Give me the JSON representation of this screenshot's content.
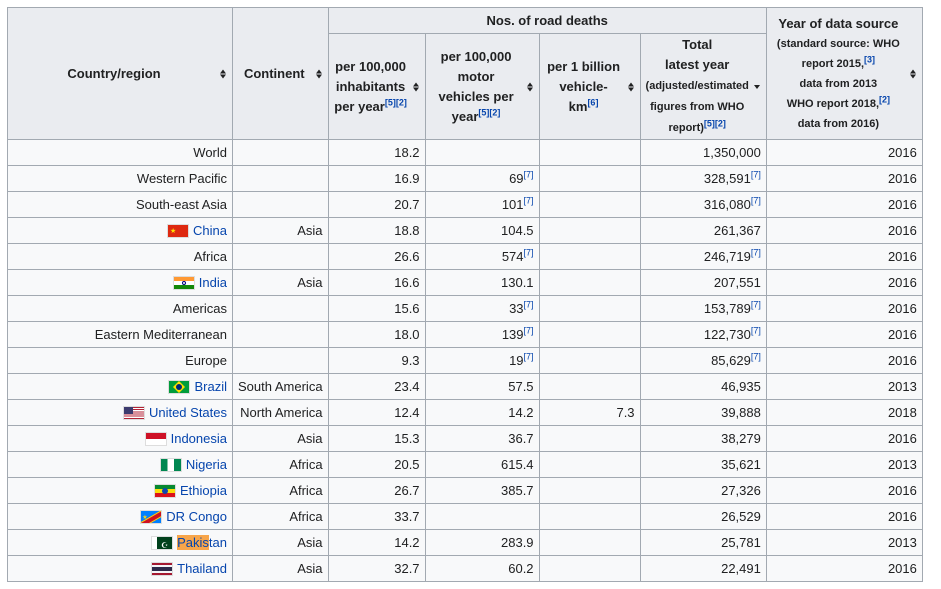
{
  "headers": {
    "country": "Country/region",
    "continent": "Continent",
    "road_deaths_group": "Nos. of road deaths",
    "per_inhabitants": "per 100,000 inhabitants per year",
    "per_inhabitants_refs": "[5][2]",
    "per_vehicles": "per 100,000 motor vehicles per year",
    "per_vehicles_refs": "[5][2]",
    "per_km_line1": "per 1 billion",
    "per_km_line2": "vehicle-km",
    "per_km_refs": "[6]",
    "total_line1": "Total",
    "total_line2": "latest year",
    "total_sub": "(adjusted/estimated figures from WHO report)",
    "total_refs": "[5][2]",
    "year_title": "Year of data source",
    "year_sub1": "(standard source: WHO report 2015,",
    "year_sub1_ref": "[3]",
    "year_sub2": "data from 2013",
    "year_sub3": "WHO report 2018,",
    "year_sub3_ref": "[2]",
    "year_sub4": "data from 2016)"
  },
  "rows": [
    {
      "name": "World",
      "link": false,
      "flag": "",
      "continent": "",
      "inh": "18.2",
      "veh": "",
      "veh_ref": "",
      "km": "",
      "total": "1,350,000",
      "total_ref": "",
      "year": "2016"
    },
    {
      "name": "Western Pacific",
      "link": false,
      "flag": "",
      "continent": "",
      "inh": "16.9",
      "veh": "69",
      "veh_ref": "[7]",
      "km": "",
      "total": "328,591",
      "total_ref": "[7]",
      "year": "2016"
    },
    {
      "name": "South-east Asia",
      "link": false,
      "flag": "",
      "continent": "",
      "inh": "20.7",
      "veh": "101",
      "veh_ref": "[7]",
      "km": "",
      "total": "316,080",
      "total_ref": "[7]",
      "year": "2016"
    },
    {
      "name": "China",
      "link": true,
      "flag": "china",
      "continent": "Asia",
      "inh": "18.8",
      "veh": "104.5",
      "veh_ref": "",
      "km": "",
      "total": "261,367",
      "total_ref": "",
      "year": "2016"
    },
    {
      "name": "Africa",
      "link": false,
      "flag": "",
      "continent": "",
      "inh": "26.6",
      "veh": "574",
      "veh_ref": "[7]",
      "km": "",
      "total": "246,719",
      "total_ref": "[7]",
      "year": "2016"
    },
    {
      "name": "India",
      "link": true,
      "flag": "india",
      "continent": "Asia",
      "inh": "16.6",
      "veh": "130.1",
      "veh_ref": "",
      "km": "",
      "total": "207,551",
      "total_ref": "",
      "year": "2016"
    },
    {
      "name": "Americas",
      "link": false,
      "flag": "",
      "continent": "",
      "inh": "15.6",
      "veh": "33",
      "veh_ref": "[7]",
      "km": "",
      "total": "153,789",
      "total_ref": "[7]",
      "year": "2016"
    },
    {
      "name": "Eastern Mediterranean",
      "link": false,
      "flag": "",
      "continent": "",
      "inh": "18.0",
      "veh": "139",
      "veh_ref": "[7]",
      "km": "",
      "total": "122,730",
      "total_ref": "[7]",
      "year": "2016"
    },
    {
      "name": "Europe",
      "link": false,
      "flag": "",
      "continent": "",
      "inh": "9.3",
      "veh": "19",
      "veh_ref": "[7]",
      "km": "",
      "total": "85,629",
      "total_ref": "[7]",
      "year": "2016"
    },
    {
      "name": "Brazil",
      "link": true,
      "flag": "brazil",
      "continent": "South America",
      "inh": "23.4",
      "veh": "57.5",
      "veh_ref": "",
      "km": "",
      "total": "46,935",
      "total_ref": "",
      "year": "2013"
    },
    {
      "name": "United States",
      "link": true,
      "flag": "us",
      "continent": "North America",
      "inh": "12.4",
      "veh": "14.2",
      "veh_ref": "",
      "km": "7.3",
      "total": "39,888",
      "total_ref": "",
      "year": "2018"
    },
    {
      "name": "Indonesia",
      "link": true,
      "flag": "indonesia",
      "continent": "Asia",
      "inh": "15.3",
      "veh": "36.7",
      "veh_ref": "",
      "km": "",
      "total": "38,279",
      "total_ref": "",
      "year": "2016"
    },
    {
      "name": "Nigeria",
      "link": true,
      "flag": "nigeria",
      "continent": "Africa",
      "inh": "20.5",
      "veh": "615.4",
      "veh_ref": "",
      "km": "",
      "total": "35,621",
      "total_ref": "",
      "year": "2013"
    },
    {
      "name": "Ethiopia",
      "link": true,
      "flag": "ethiopia",
      "continent": "Africa",
      "inh": "26.7",
      "veh": "385.7",
      "veh_ref": "",
      "km": "",
      "total": "27,326",
      "total_ref": "",
      "year": "2016"
    },
    {
      "name": "DR Congo",
      "link": true,
      "flag": "drc",
      "continent": "Africa",
      "inh": "33.7",
      "veh": "",
      "veh_ref": "",
      "km": "",
      "total": "26,529",
      "total_ref": "",
      "year": "2016"
    },
    {
      "name": "Pakistan",
      "link": true,
      "flag": "pakistan",
      "continent": "Asia",
      "inh": "14.2",
      "veh": "283.9",
      "veh_ref": "",
      "km": "",
      "total": "25,781",
      "total_ref": "",
      "year": "2013",
      "highlight": "Pakis"
    },
    {
      "name": "Thailand",
      "link": true,
      "flag": "thailand",
      "continent": "Asia",
      "inh": "32.7",
      "veh": "60.2",
      "veh_ref": "",
      "km": "",
      "total": "22,491",
      "total_ref": "",
      "year": "2016"
    }
  ],
  "icons": {
    "sort": "sort-both-icon",
    "sort_desc": "sort-descending-icon"
  },
  "colors": {
    "link": "#0645ad",
    "header_bg": "#eaecf0",
    "border": "#a2a9b1",
    "highlight": "#f7a54a"
  }
}
